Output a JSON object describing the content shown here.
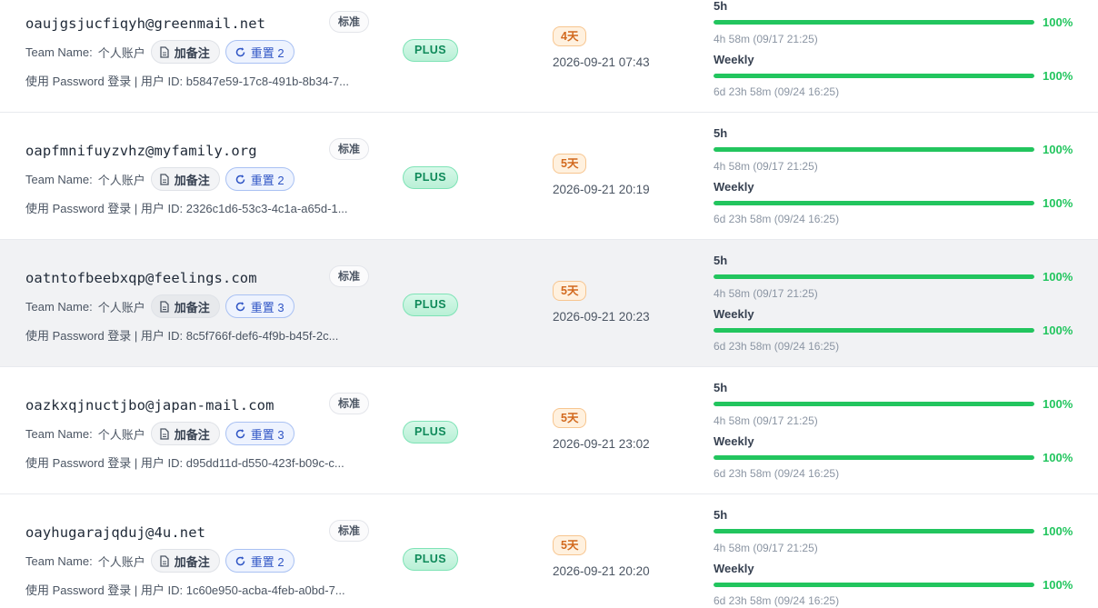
{
  "labels": {
    "tier": "标准",
    "team_label": "Team Name:",
    "team_name": "个人账户",
    "note_button": "加备注",
    "plan": "PLUS",
    "quota_short": "5h",
    "quota_weekly": "Weekly"
  },
  "colors": {
    "accent_green": "#22c55e",
    "reset_blue": "#2f55c5",
    "days_orange": "#d2691e"
  },
  "icons": {
    "note": "document-icon",
    "reset": "refresh-icon"
  },
  "accounts": [
    {
      "email": "oaujgsjucfiqyh@greenmail.net",
      "reset_label": "重置 2",
      "login": "使用 Password 登录 | 用户 ID: b5847e59-17c8-491b-8b34-7...",
      "days": "4天",
      "expire": "2026-09-21 07:43",
      "quota_5h": {
        "percent": 100,
        "percent_label": "100%",
        "reset": "4h 58m (09/17 21:25)"
      },
      "quota_weekly": {
        "percent": 100,
        "percent_label": "100%",
        "reset": "6d 23h 58m (09/24 16:25)"
      }
    },
    {
      "email": "oapfmnifuyzvhz@myfamily.org",
      "reset_label": "重置 2",
      "login": "使用 Password 登录 | 用户 ID: 2326c1d6-53c3-4c1a-a65d-1...",
      "days": "5天",
      "expire": "2026-09-21 20:19",
      "quota_5h": {
        "percent": 100,
        "percent_label": "100%",
        "reset": "4h 58m (09/17 21:25)"
      },
      "quota_weekly": {
        "percent": 100,
        "percent_label": "100%",
        "reset": "6d 23h 58m (09/24 16:25)"
      }
    },
    {
      "email": "oatntofbeebxqp@feelings.com",
      "reset_label": "重置 3",
      "login": "使用 Password 登录 | 用户 ID: 8c5f766f-def6-4f9b-b45f-2c...",
      "days": "5天",
      "expire": "2026-09-21 20:23",
      "quota_5h": {
        "percent": 100,
        "percent_label": "100%",
        "reset": "4h 58m (09/17 21:25)"
      },
      "quota_weekly": {
        "percent": 100,
        "percent_label": "100%",
        "reset": "6d 23h 58m (09/24 16:25)"
      }
    },
    {
      "email": "oazkxqjnuctjbo@japan-mail.com",
      "reset_label": "重置 3",
      "login": "使用 Password 登录 | 用户 ID: d95dd11d-d550-423f-b09c-c...",
      "days": "5天",
      "expire": "2026-09-21 23:02",
      "quota_5h": {
        "percent": 100,
        "percent_label": "100%",
        "reset": "4h 58m (09/17 21:25)"
      },
      "quota_weekly": {
        "percent": 100,
        "percent_label": "100%",
        "reset": "6d 23h 58m (09/24 16:25)"
      }
    },
    {
      "email": "oayhugarajqduj@4u.net",
      "reset_label": "重置 2",
      "login": "使用 Password 登录 | 用户 ID: 1c60e950-acba-4feb-a0bd-7...",
      "days": "5天",
      "expire": "2026-09-21 20:20",
      "quota_5h": {
        "percent": 100,
        "percent_label": "100%",
        "reset": "4h 58m (09/17 21:25)"
      },
      "quota_weekly": {
        "percent": 100,
        "percent_label": "100%",
        "reset": "6d 23h 58m (09/24 16:25)"
      }
    }
  ]
}
